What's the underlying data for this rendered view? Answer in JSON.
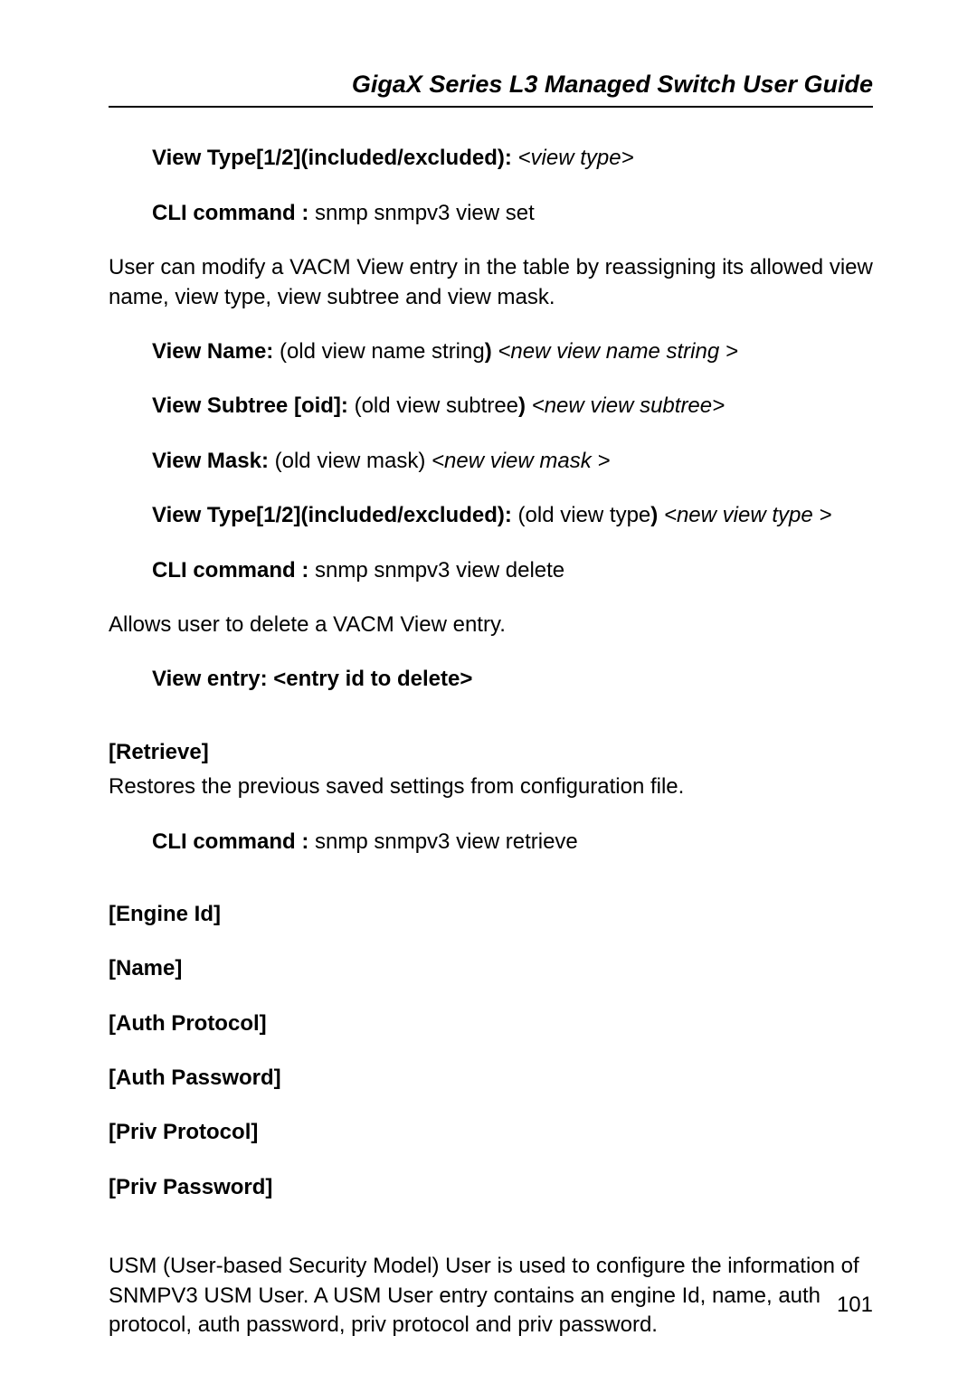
{
  "header": {
    "title": "GigaX Series L3 Managed Switch User Guide"
  },
  "lines": {
    "l1_bold": "View Type[1/2](included/excluded): ",
    "l1_ital": "<view type>",
    "l2_bold": "CLI command :",
    "l2_rest": " snmp snmpv3 view set",
    "l3": "User can modify a VACM View entry in the table by reassigning its allowed view name, view type, view subtree and view mask.",
    "l4_bold": "View Name: ",
    "l4_norm": "(old view name string",
    "l4_close": ") ",
    "l4_ital": "<new view name string >",
    "l5_bold": "View Subtree [oid]: ",
    "l5_norm": "(old view subtree",
    "l5_close": ") ",
    "l5_ital": "<new view subtree>",
    "l6_bold": "View Mask: ",
    "l6_norm": "(old view mask) ",
    "l6_ital": "<new view mask >",
    "l7_bold": "View Type[1/2](included/excluded): ",
    "l7_norm": "(old view type",
    "l7_close": ") ",
    "l7_ital": "<new view type >",
    "l8_bold": "CLI command :",
    "l8_rest": " snmp snmpv3 view delete",
    "l9": "Allows user to delete a VACM View entry.",
    "l10_bold": "View entry: <entry id to delete>",
    "l11_bold": "[Retrieve]",
    "l12": "Restores the previous saved settings from configuration file.",
    "l13_bold": "CLI command :",
    "l13_rest": " snmp snmpv3 view retrieve",
    "l14_bold": "[Engine Id]",
    "l15_bold": "[Name]",
    "l16_bold": "[Auth Protocol]",
    "l17_bold": "[Auth Password]",
    "l18_bold": "[Priv Protocol]",
    "l19_bold": "[Priv Password]",
    "l20": "USM (User-based Security Model) User is used to configure the information of SNMPV3 USM User. A USM User entry contains an engine Id, name, auth protocol, auth password, priv protocol and priv password."
  },
  "page_number": "101"
}
